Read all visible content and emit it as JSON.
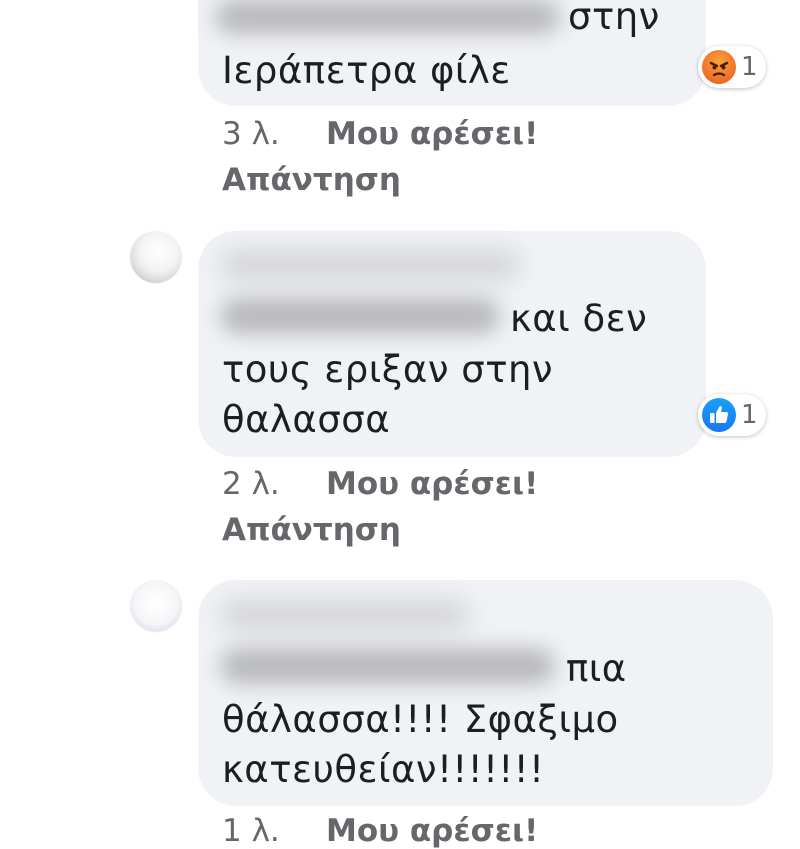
{
  "comments": [
    {
      "text_lines": [
        "στην",
        "Ιεράπετρα φίλε"
      ],
      "reaction": {
        "icon": "angry-reaction-icon",
        "count": "1"
      },
      "time": "3 λ.",
      "like_label": "Μου αρέσει!",
      "reply_label": "Απάντηση"
    },
    {
      "text_lines": [
        "και δεν",
        "τους εριξαν στην",
        "θαλασσα"
      ],
      "reaction": {
        "icon": "like-reaction-icon",
        "count": "1"
      },
      "time": "2 λ.",
      "like_label": "Μου αρέσει!",
      "reply_label": "Απάντηση"
    },
    {
      "text_lines": [
        "πια",
        "θάλασσα!!!! Σφαξιμο",
        "κατευθείαν!!!!!!!"
      ],
      "time": "1 λ.",
      "like_label": "Μου αρέσει!"
    }
  ],
  "colors": {
    "bubble": "#f0f2f5",
    "meta_text": "#65676b",
    "like_blue": "#1877f2",
    "angry_orange": "#f0782c"
  }
}
